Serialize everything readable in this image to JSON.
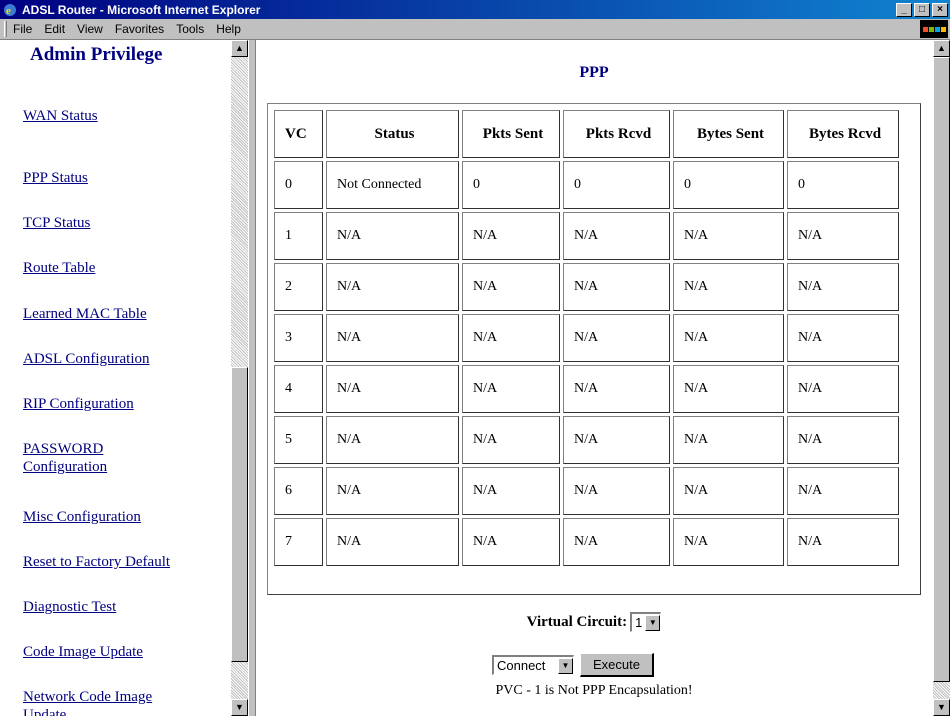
{
  "window": {
    "title": "ADSL Router - Microsoft Internet Explorer",
    "controls": [
      "_",
      "□",
      "×"
    ]
  },
  "menu": [
    "File",
    "Edit",
    "View",
    "Favorites",
    "Tools",
    "Help"
  ],
  "sidebar": {
    "title": "Admin Privilege",
    "links": [
      "WAN Status",
      "PPP Status",
      "TCP Status",
      "Route Table",
      "Learned MAC Table",
      "ADSL Configuration",
      "RIP Configuration",
      "PASSWORD Configuration",
      "Misc Configuration",
      "Reset to Factory Default",
      "Diagnostic Test",
      "Code Image Update",
      "Network Code Image Update"
    ]
  },
  "main": {
    "title": "PPP",
    "table": {
      "headers": [
        "VC",
        "Status",
        "Pkts Sent",
        "Pkts Rcvd",
        "Bytes Sent",
        "Bytes Rcvd"
      ],
      "rows": [
        [
          "0",
          "Not Connected",
          "0",
          "0",
          "0",
          "0"
        ],
        [
          "1",
          "N/A",
          "N/A",
          "N/A",
          "N/A",
          "N/A"
        ],
        [
          "2",
          "N/A",
          "N/A",
          "N/A",
          "N/A",
          "N/A"
        ],
        [
          "3",
          "N/A",
          "N/A",
          "N/A",
          "N/A",
          "N/A"
        ],
        [
          "4",
          "N/A",
          "N/A",
          "N/A",
          "N/A",
          "N/A"
        ],
        [
          "5",
          "N/A",
          "N/A",
          "N/A",
          "N/A",
          "N/A"
        ],
        [
          "6",
          "N/A",
          "N/A",
          "N/A",
          "N/A",
          "N/A"
        ],
        [
          "7",
          "N/A",
          "N/A",
          "N/A",
          "N/A",
          "N/A"
        ]
      ]
    },
    "virtual_circuit": {
      "label": "Virtual Circuit:",
      "value": "1"
    },
    "action": {
      "value": "Connect",
      "execute_label": "Execute"
    },
    "message": "PVC - 1 is Not PPP Encapsulation!"
  }
}
